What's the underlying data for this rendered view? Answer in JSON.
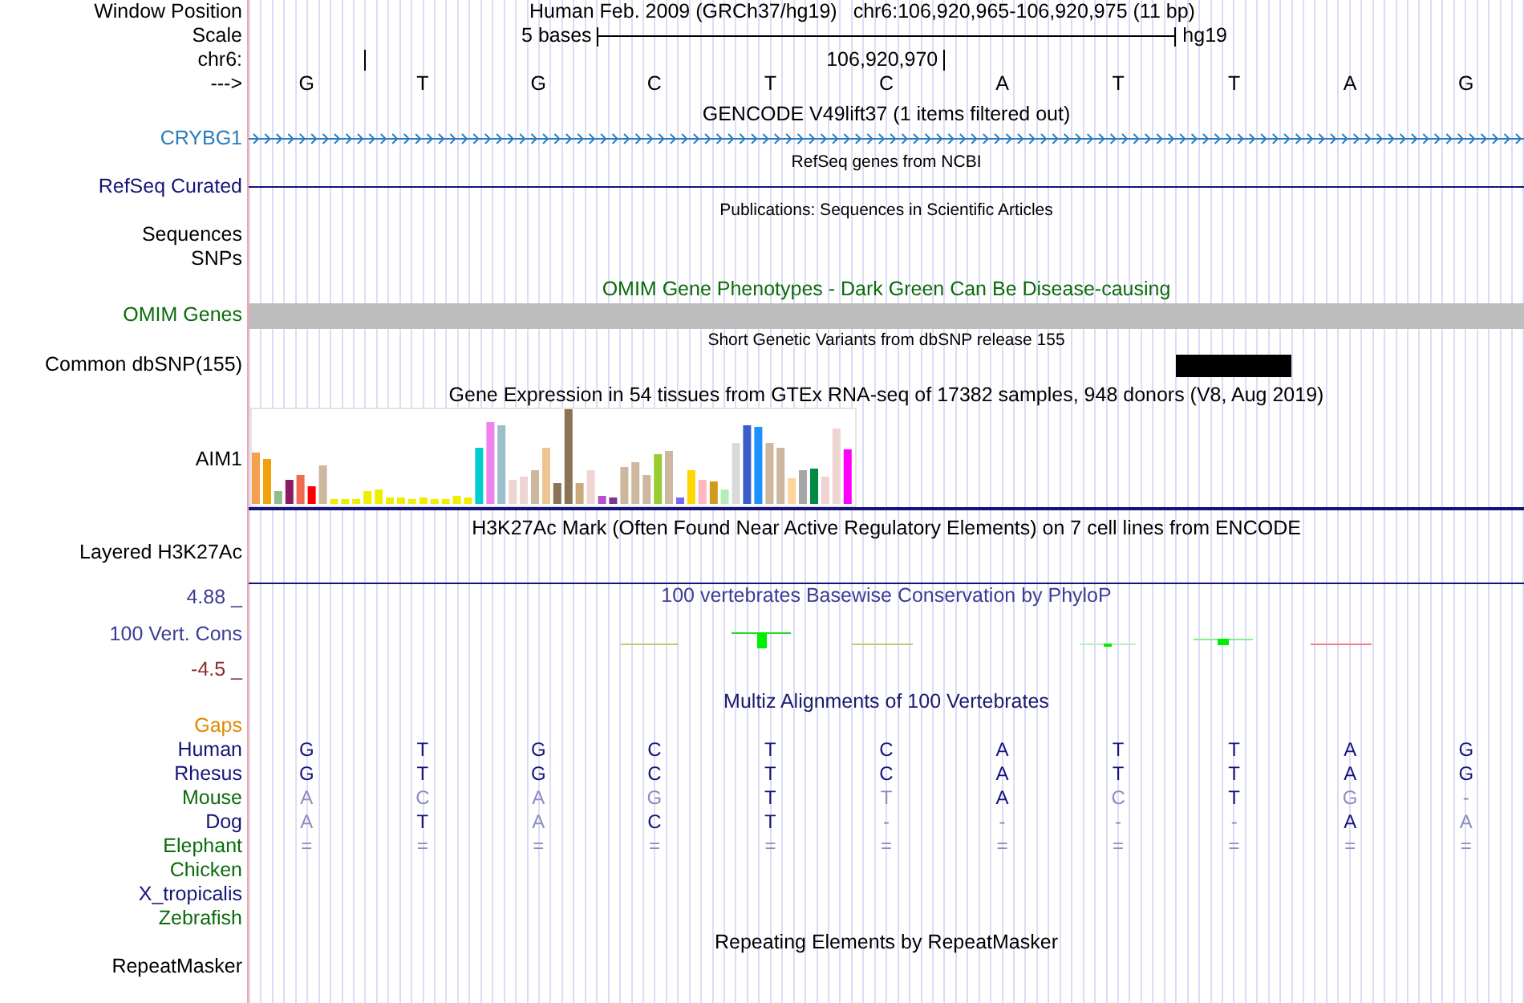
{
  "header": {
    "position_label": "Window Position",
    "assembly": "Human Feb. 2009 (GRCh37/hg19)",
    "location": "chr6:106,920,965-106,920,975 (11 bp)",
    "scale_label": "Scale",
    "scale_text": "5 bases",
    "scale_assembly": "hg19",
    "chrom_label": "chr6:",
    "coordinate": "106,920,970",
    "strand_label": "--->",
    "bases": [
      "G",
      "T",
      "G",
      "C",
      "T",
      "C",
      "A",
      "T",
      "T",
      "A",
      "G"
    ]
  },
  "tracks": [
    {
      "kind": "gene",
      "title": "GENCODE V49lift37 (1 items filtered out)",
      "label": "CRYBG1"
    },
    {
      "kind": "line",
      "title": "RefSeq genes from NCBI",
      "label": "RefSeq Curated"
    },
    {
      "kind": "list",
      "title": "Publications: Sequences in Scientific Articles",
      "labels": [
        "Sequences",
        "SNPs"
      ]
    },
    {
      "kind": "block",
      "title": "OMIM Gene Phenotypes - Dark Green Can Be Disease-causing",
      "label": "OMIM Genes"
    },
    {
      "kind": "variants",
      "title": "Short Genetic Variants from dbSNP release 155",
      "label": "Common dbSNP(155)"
    },
    {
      "kind": "expression",
      "title": "Gene Expression in 54 tissues from GTEx RNA-seq of 17382 samples, 948 donors (V8, Aug 2019)",
      "label": "AIM1"
    },
    {
      "kind": "signal",
      "title": "H3K27Ac Mark (Often Found Near Active Regulatory Elements) on 7 cell lines from ENCODE",
      "label": "Layered H3K27Ac"
    },
    {
      "kind": "conservation",
      "title": "100 vertebrates Basewise Conservation by PhyloP",
      "label": "100 Vert. Cons",
      "max": "4.88 _",
      "min": "-4.5 _"
    },
    {
      "kind": "alignment",
      "title": "Multiz Alignments of 100 Vertebrates",
      "gaps_label": "Gaps",
      "species": [
        {
          "name": "Human",
          "color": "#14147a",
          "bases": [
            {
              "base": "G",
              "match": true
            },
            {
              "base": "T",
              "match": true
            },
            {
              "base": "G",
              "match": true
            },
            {
              "base": "C",
              "match": true
            },
            {
              "base": "T",
              "match": true
            },
            {
              "base": "C",
              "match": true
            },
            {
              "base": "A",
              "match": true
            },
            {
              "base": "T",
              "match": true
            },
            {
              "base": "T",
              "match": true
            },
            {
              "base": "A",
              "match": true
            },
            {
              "base": "G",
              "match": true
            }
          ]
        },
        {
          "name": "Rhesus",
          "color": "#14147a",
          "bases": [
            {
              "base": "G",
              "match": true
            },
            {
              "base": "T",
              "match": true
            },
            {
              "base": "G",
              "match": true
            },
            {
              "base": "C",
              "match": true
            },
            {
              "base": "T",
              "match": true
            },
            {
              "base": "C",
              "match": true
            },
            {
              "base": "A",
              "match": true
            },
            {
              "base": "T",
              "match": true
            },
            {
              "base": "T",
              "match": true
            },
            {
              "base": "A",
              "match": true
            },
            {
              "base": "G",
              "match": true
            }
          ]
        },
        {
          "name": "Mouse",
          "color": "#0b6b0b",
          "bases": [
            {
              "base": "A",
              "match": false
            },
            {
              "base": "C",
              "match": false
            },
            {
              "base": "A",
              "match": false
            },
            {
              "base": "G",
              "match": false
            },
            {
              "base": "T",
              "match": true
            },
            {
              "base": "T",
              "match": false
            },
            {
              "base": "A",
              "match": true
            },
            {
              "base": "C",
              "match": false
            },
            {
              "base": "T",
              "match": true
            },
            {
              "base": "G",
              "match": false
            },
            {
              "base": "-",
              "match": false
            }
          ]
        },
        {
          "name": "Dog",
          "color": "#14147a",
          "bases": [
            {
              "base": "A",
              "match": false
            },
            {
              "base": "T",
              "match": true
            },
            {
              "base": "A",
              "match": false
            },
            {
              "base": "C",
              "match": true
            },
            {
              "base": "T",
              "match": true
            },
            {
              "base": "-",
              "match": false
            },
            {
              "base": "-",
              "match": false
            },
            {
              "base": "-",
              "match": false
            },
            {
              "base": "-",
              "match": false
            },
            {
              "base": "A",
              "match": true
            },
            {
              "base": "A",
              "match": false
            }
          ]
        },
        {
          "name": "Elephant",
          "color": "#0b6b0b",
          "bases": [
            {
              "base": "=",
              "match": false
            },
            {
              "base": "=",
              "match": false
            },
            {
              "base": "=",
              "match": false
            },
            {
              "base": "=",
              "match": false
            },
            {
              "base": "=",
              "match": false
            },
            {
              "base": "=",
              "match": false
            },
            {
              "base": "=",
              "match": false
            },
            {
              "base": "=",
              "match": false
            },
            {
              "base": "=",
              "match": false
            },
            {
              "base": "=",
              "match": false
            },
            {
              "base": "=",
              "match": false
            }
          ]
        },
        {
          "name": "Chicken",
          "color": "#0b6b0b"
        },
        {
          "name": "X_tropicalis",
          "color": "#14147a"
        },
        {
          "name": "Zebrafish",
          "color": "#0b6b0b"
        }
      ]
    },
    {
      "kind": "repeats",
      "title": "Repeating Elements by RepeatMasker",
      "label": "RepeatMasker"
    }
  ]
}
